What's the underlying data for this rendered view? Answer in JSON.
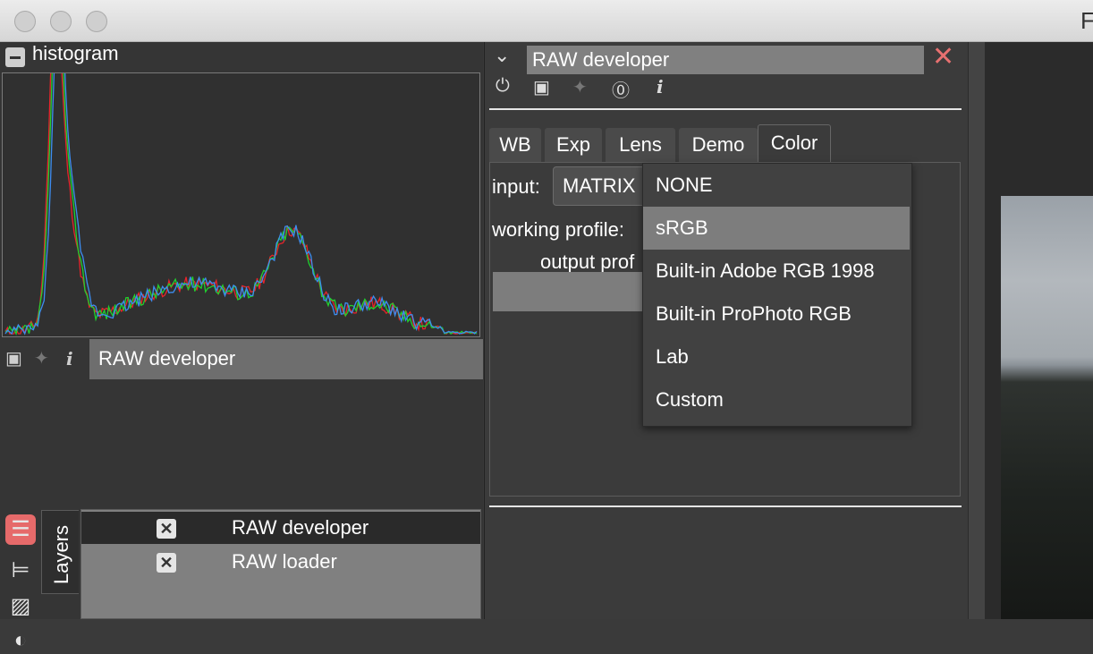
{
  "window": {
    "title": "F"
  },
  "histogram": {
    "title": "histogram",
    "module_name": "RAW developer",
    "colors": {
      "red": "#e8232a",
      "green": "#1fd12e",
      "blue": "#3d8df0"
    }
  },
  "layers": {
    "tab_label": "Layers",
    "items": [
      {
        "name": "RAW developer",
        "selected": true,
        "enabled": true
      },
      {
        "name": "RAW loader",
        "selected": false,
        "enabled": true
      }
    ]
  },
  "panel": {
    "title": "RAW developer",
    "tabs": [
      "WB",
      "Exp",
      "Lens",
      "Demo",
      "Color"
    ],
    "active_tab": "Color",
    "input_label": "input:",
    "input_value": "MATRIX",
    "working_profile_label": "working profile:",
    "output_profile_label": "output prof"
  },
  "dropdown": {
    "options": [
      "NONE",
      "sRGB",
      "Built-in Adobe RGB 1998",
      "Built-in ProPhoto RGB",
      "Lab",
      "Custom"
    ],
    "highlighted": "sRGB"
  },
  "icons": {
    "collapse": "minus-icon",
    "camera": "camera-icon",
    "pin": "pin-icon",
    "info": "info-icon",
    "power": "power-icon",
    "reset": "reset-icon",
    "close": "close-icon",
    "chevron": "chevron-down-icon",
    "layers": "layers-icon",
    "tree": "tree-icon",
    "image": "image-icon",
    "contrast": "contrast-icon"
  },
  "accent": "#e66a6a"
}
